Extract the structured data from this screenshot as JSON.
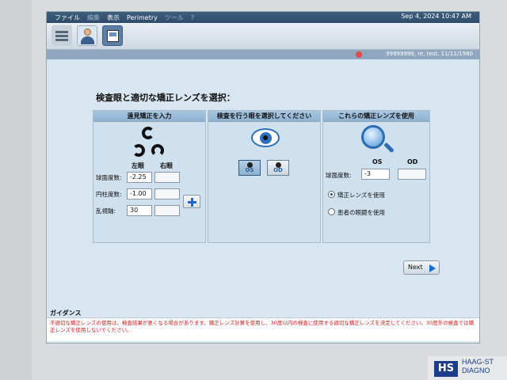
{
  "menubar": {
    "items": [
      "ファイル",
      "編集",
      "表示",
      "Perimetry",
      "ツール",
      "?"
    ],
    "date": "Sep 4, 2024 10:47 AM"
  },
  "patient": {
    "text": "99999999, re, test, 11/11/1980"
  },
  "page_title": "検査眼と適切な矯正レンズを選択：",
  "panel1": {
    "title": "遠見矯正を入力",
    "left_eye": "左眼",
    "right_eye": "右眼",
    "rows": [
      {
        "label": "球面度数:",
        "left": "-2.25",
        "right": ""
      },
      {
        "label": "円柱度数:",
        "left": "-1.00",
        "right": ""
      },
      {
        "label": "乱視軸:",
        "left": "30",
        "right": ""
      }
    ]
  },
  "panel2": {
    "title": "検査を行う眼を選択してください",
    "os_label": "OS",
    "od_label": "OD"
  },
  "panel3": {
    "title": "これらの矯正レンズを使用",
    "os_header": "OS",
    "od_header": "OD",
    "sphere_label": "球面度数:",
    "sphere_os": "-3",
    "sphere_od": "",
    "option1": "矯正レンズを使用",
    "option2": "患者の眼鏡を使用"
  },
  "next_label": "Next",
  "guidance": {
    "title": "ガイダンス",
    "text": "不適切な矯正レンズの使用は、検査結果が悪くなる場合があります。矯正レンズ計算を使用し、30度以内の検査に使用する適切な矯正レンズを決定してください。30度外の検査では矯正レンズを使用しないでください。"
  },
  "brand": {
    "line1": "HAAG-ST",
    "line2": "DIAGNO"
  }
}
